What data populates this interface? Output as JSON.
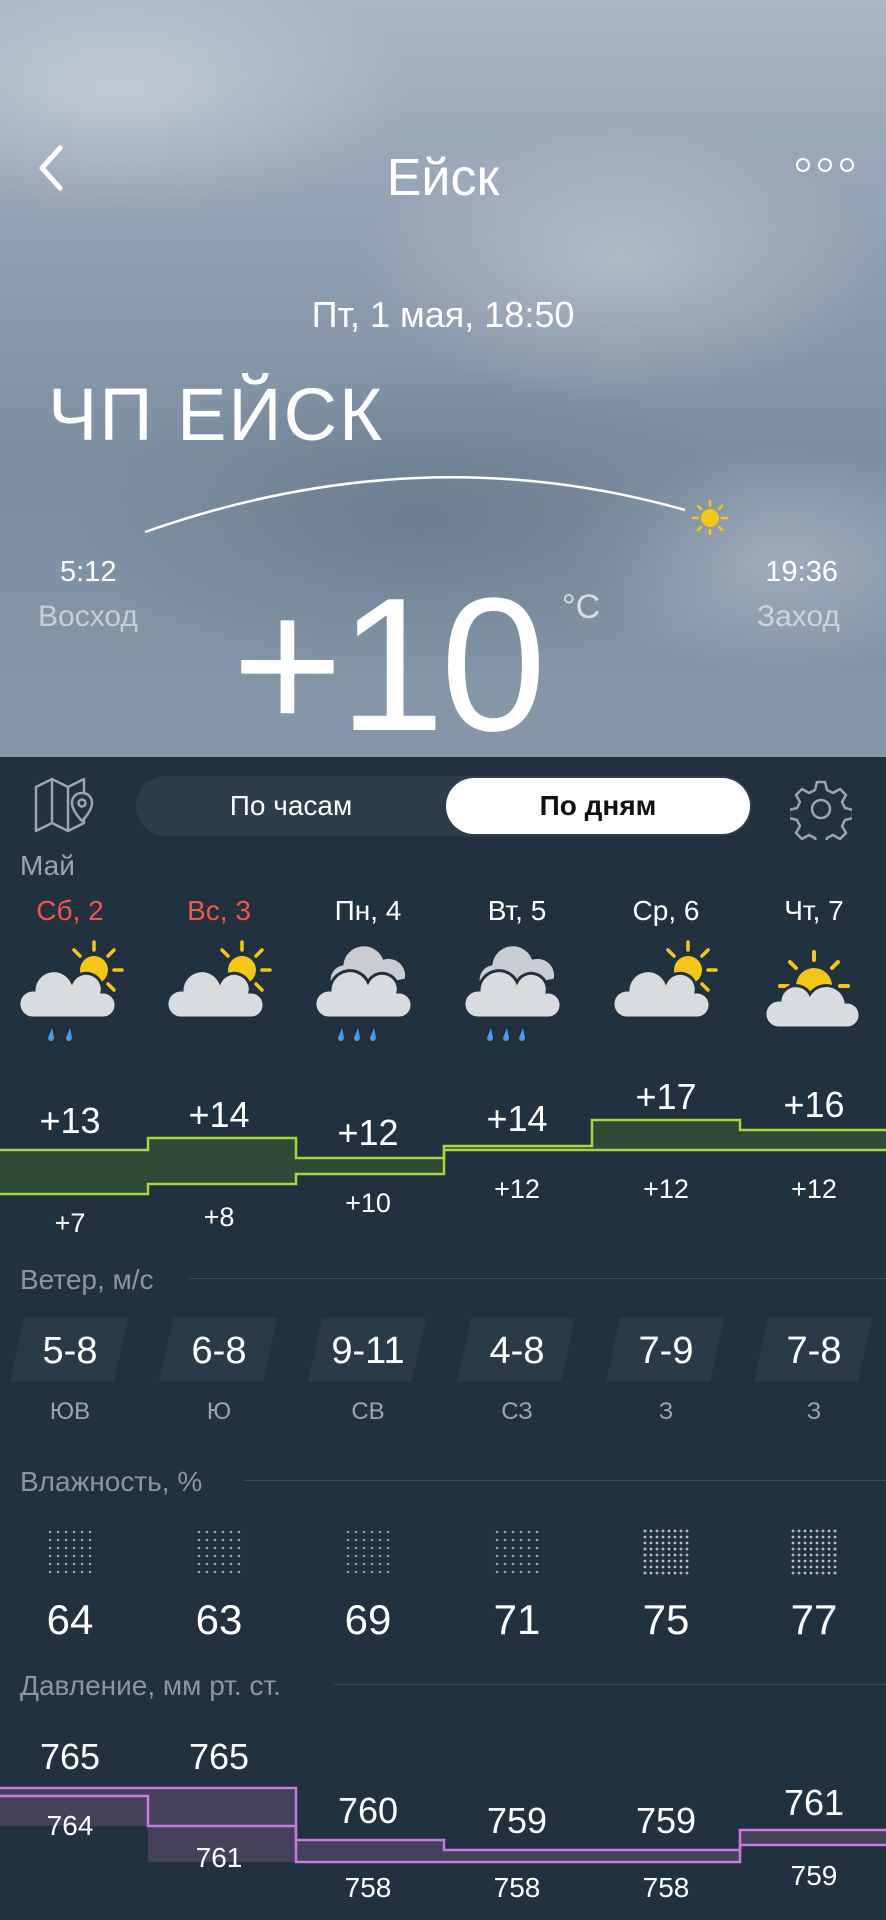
{
  "header": {
    "city": "Ейск",
    "date": "Пт, 1 мая, 18:50",
    "brand": "ЧП ЕЙСК",
    "sunrise_time": "5:12",
    "sunrise_label": "Восход",
    "sunset_time": "19:36",
    "sunset_label": "Заход",
    "temperature": "+10",
    "unit": "°C"
  },
  "toolbar": {
    "hours_label": "По часам",
    "days_label": "По дням"
  },
  "month": "Май",
  "days": [
    {
      "name": "Сб, 2",
      "weekend": true,
      "icon": "partly-cloudy-rain-icon",
      "max": "+13",
      "min": "+7",
      "wind": "5-8",
      "dir": "ЮВ",
      "humidity": "64",
      "p_max": "765",
      "p_min": "764"
    },
    {
      "name": "Вс, 3",
      "weekend": true,
      "icon": "partly-cloudy-icon",
      "max": "+14",
      "min": "+8",
      "wind": "6-8",
      "dir": "Ю",
      "humidity": "63",
      "p_max": "765",
      "p_min": "761"
    },
    {
      "name": "Пн, 4",
      "weekend": false,
      "icon": "cloud-rain-icon",
      "max": "+12",
      "min": "+10",
      "wind": "9-11",
      "dir": "СВ",
      "humidity": "69",
      "p_max": "760",
      "p_min": "758"
    },
    {
      "name": "Вт, 5",
      "weekend": false,
      "icon": "cloud-rain-icon",
      "max": "+14",
      "min": "+12",
      "wind": "4-8",
      "dir": "СЗ",
      "humidity": "71",
      "p_max": "759",
      "p_min": "758"
    },
    {
      "name": "Ср, 6",
      "weekend": false,
      "icon": "partly-cloudy-icon",
      "max": "+17",
      "min": "+12",
      "wind": "7-9",
      "dir": "З",
      "humidity": "75",
      "p_max": "759",
      "p_min": "758"
    },
    {
      "name": "Чт, 7",
      "weekend": false,
      "icon": "sun-behind-cloud-icon",
      "max": "+16",
      "min": "+12",
      "wind": "7-8",
      "dir": "З",
      "humidity": "77",
      "p_max": "761",
      "p_min": "759"
    }
  ],
  "sections": {
    "wind": "Ветер, м/с",
    "humidity": "Влажность, %",
    "pressure": "Давление, мм рт. ст."
  },
  "colors": {
    "temp_line": "#a6d63a",
    "press_line": "#c77be0",
    "weekend": "#f0564a",
    "rain": "#3f9cf0",
    "sun": "#f5c518"
  }
}
